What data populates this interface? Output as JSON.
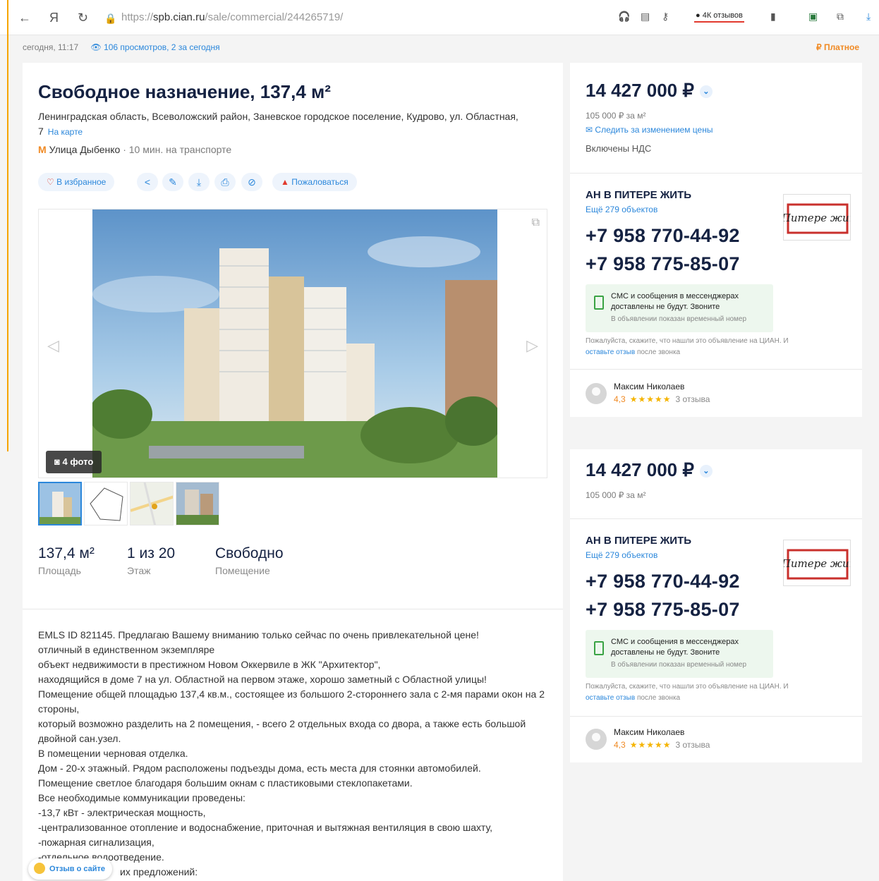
{
  "browser": {
    "url_prefix": "https://",
    "url_domain": "spb.cian.ru",
    "url_path": "/sale/commercial/244265719/",
    "reviews_pill": "4К отзывов"
  },
  "meta": {
    "time": "сегодня, 11:17",
    "views": "106 просмотров, 2 за сегодня",
    "paid": "Платное"
  },
  "listing": {
    "title": "Свободное назначение, 137,4 м²",
    "address": "Ленинградская область, Всеволожский район, Заневское городское поселение, Кудрово, ул. Областная, 7",
    "map_link": "На карте",
    "metro_icon": "M",
    "metro_station": "Улица Дыбенко",
    "metro_time": "· 10 мин. на транспорте",
    "actions": {
      "favorite": "В избранное",
      "complain": "Пожаловаться"
    },
    "photo_count": "4 фото",
    "params": [
      {
        "value": "137,4 м²",
        "label": "Площадь"
      },
      {
        "value": "1 из 20",
        "label": "Этаж"
      },
      {
        "value": "Свободно",
        "label": "Помещение"
      }
    ],
    "description": [
      "EMLS ID 821145. Предлагаю Вашему вниманию только сейчас по очень привлекательной цене!",
      "отличный в единственном экземпляре",
      "объект недвижимости в престижном Новом Оккервиле в ЖК \"Архитектор\",",
      "находящийся в доме 7 на ул. Областной на первом этаже, хорошо заметный с Областной улицы!",
      "Помещение общей площадью 137,4 кв.м., состоящее из большого 2-стороннего зала с 2-мя парами окон на 2 стороны,",
      "который возможно разделить на 2 помещения, - всего 2 отдельных входа со двора, а также есть большой двойной сан.узел.",
      "В помещении черновая отделка.",
      "Дом - 20-х этажный. Рядом расположены подъезды дома, есть места для стоянки автомобилей.",
      "Помещение светлое благодаря большим окнам с пластиковыми стеклопакетами.",
      "Все необходимые коммуникации проведены:",
      "-13,7 кВт - электрическая мощность,",
      "-централизованное отопление и водоснабжение, приточная и вытяжная вентиляция в свою шахту,",
      "-пожарная сигнализация,",
      "-отдельное водоотведение.",
      "их предложений:"
    ],
    "feedback_button": "Отзыв о сайте"
  },
  "sidebar": {
    "price": "14 427 000 ₽",
    "price_per_m": "105 000 ₽ за м²",
    "follow_price": "Следить за изменением цены",
    "vat": "Включены НДС",
    "agency": "АН В ПИТЕРЕ ЖИТЬ",
    "more_objects": "Ещё 279 объектов",
    "phone1": "+7 958 770-44-92",
    "phone2": "+7 958 775-85-07",
    "sms_notice": "СМС и сообщения в мессенджерах доставлены не будут. Звоните",
    "temp_number": "В объявлении показан временный номер",
    "please_say": "Пожалуйста, скажите, что нашли это объявление на ЦИАН. И",
    "leave_review": "оставьте отзыв",
    "after_call": "после звонка",
    "agent_name": "Максим Николаев",
    "rating": "4,3",
    "stars": "★★★★★",
    "reviews_count": "3 отзыва",
    "logo_text": "В Питере жить"
  },
  "colors": {
    "accent": "#2b87db",
    "orange": "#f08a24",
    "title": "#152242"
  }
}
